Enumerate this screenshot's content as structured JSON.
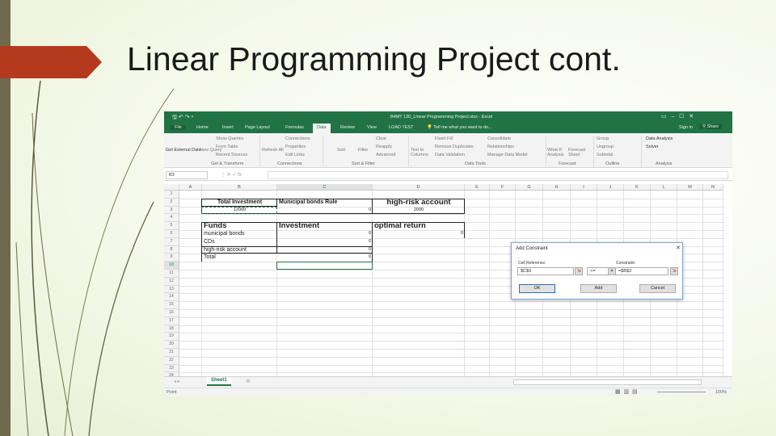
{
  "slide": {
    "title": "Linear Programming Project cont."
  },
  "excel": {
    "window_title": "B4MT 130_Linear Programming Project.xlsx - Excel",
    "tabs": [
      "File",
      "Home",
      "Insert",
      "Page Layout",
      "Formulas",
      "Data",
      "Review",
      "View",
      "LOAD TEST"
    ],
    "active_tab": "Data",
    "tell_me": "Tell me what you want to do...",
    "sign_in": "Sign in",
    "share": "Share",
    "ribbon": {
      "get_external": "Get External Data",
      "new_query": "New Query",
      "show_queries": "Show Queries",
      "from_table": "From Table",
      "recent_sources": "Recent Sources",
      "refresh_all": "Refresh All",
      "connections": "Connections",
      "properties": "Properties",
      "edit_links": "Edit Links",
      "sort": "Sort",
      "filter": "Filter",
      "clear": "Clear",
      "reapply": "Reapply",
      "advanced": "Advanced",
      "text_to_columns": "Text to Columns",
      "flash_fill": "Flash Fill",
      "remove_duplicates": "Remove Duplicates",
      "data_validation": "Data Validation",
      "consolidate": "Consolidate",
      "relationships": "Relationships",
      "manage_data_model": "Manage Data Model",
      "what_if": "What-If Analysis",
      "forecast_sheet": "Forecast Sheet",
      "group": "Group",
      "ungroup": "Ungroup",
      "subtotal": "Subtotal",
      "data_analysis": "Data Analysis",
      "solver": "Solver",
      "groups": [
        "Get & Transform",
        "Connections",
        "Sort & Filter",
        "Data Tools",
        "Forecast",
        "Outline",
        "Analysis"
      ]
    },
    "name_box": "B3",
    "columns": [
      "A",
      "B",
      "C",
      "D",
      "E",
      "F",
      "G",
      "H",
      "I",
      "J",
      "K",
      "L",
      "M",
      "N"
    ],
    "rows": [
      "1",
      "2",
      "3",
      "4",
      "5",
      "6",
      "7",
      "8",
      "9",
      "10",
      "11",
      "12",
      "13",
      "14",
      "15",
      "16",
      "17",
      "18",
      "19",
      "20",
      "21",
      "22",
      "23",
      "24"
    ],
    "cells": {
      "B2": "Total Investment",
      "C2": "Municipal bonds Rule",
      "D2": "high-risk account",
      "B3": "12000",
      "C3": "0",
      "D3": "2000",
      "B5": "Funds",
      "C5": "Investment",
      "D5": "optimal return",
      "B6": "municipal bonds",
      "C6": "0",
      "D6": "0",
      "B7": "CDs",
      "C7": "0",
      "B8": "high-risk account",
      "C8": "0",
      "B9": "Total",
      "C9": "0"
    },
    "sheet_tab": "Sheet1",
    "status": "Point",
    "zoom": "100%",
    "dialog": {
      "title": "Add Constraint",
      "cell_reference_label": "Cell Reference:",
      "cell_reference_value": "$C$9",
      "operator": "<=",
      "constraint_label": "Constraint:",
      "constraint_value": "=$B$3",
      "ok": "OK",
      "add": "Add",
      "cancel": "Cancel"
    }
  },
  "colors": {
    "excel_green": "#217346",
    "arrow": "#b5391c",
    "strip": "#6f6a4e"
  }
}
